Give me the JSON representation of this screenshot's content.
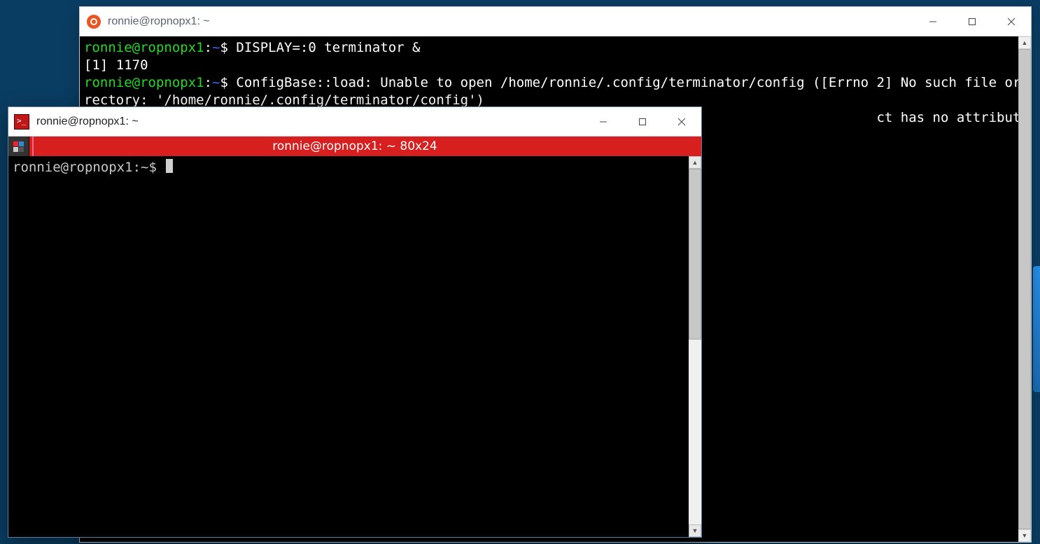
{
  "back_window": {
    "title": "ronnie@ropnopx1: ~",
    "terminal_lines": [
      {
        "kind": "prompt",
        "user": "ronnie@ropnopx1",
        "colon": ":",
        "path": "~",
        "dollar": "$ ",
        "cmd": "DISPLAY=:0 terminator &"
      },
      {
        "kind": "plain",
        "text": "[1] 1170"
      },
      {
        "kind": "prompt",
        "user": "ronnie@ropnopx1",
        "colon": ":",
        "path": "~",
        "dollar": "$ ",
        "cmd": "ConfigBase::load: Unable to open /home/ronnie/.config/terminator/config ([Errno 2] No such file or di"
      },
      {
        "kind": "plain",
        "text": "rectory: '/home/ronnie/.config/terminator/config')"
      },
      {
        "kind": "gap",
        "text": "                                                                                                   ct has no attribute 'AVAILABLE'"
      }
    ]
  },
  "front_window": {
    "title": "ronnie@ropnopx1: ~",
    "redbar_title": "ronnie@ropnopx1: ~ 80x24",
    "prompt_text": "ronnie@ropnopx1:~$ "
  }
}
